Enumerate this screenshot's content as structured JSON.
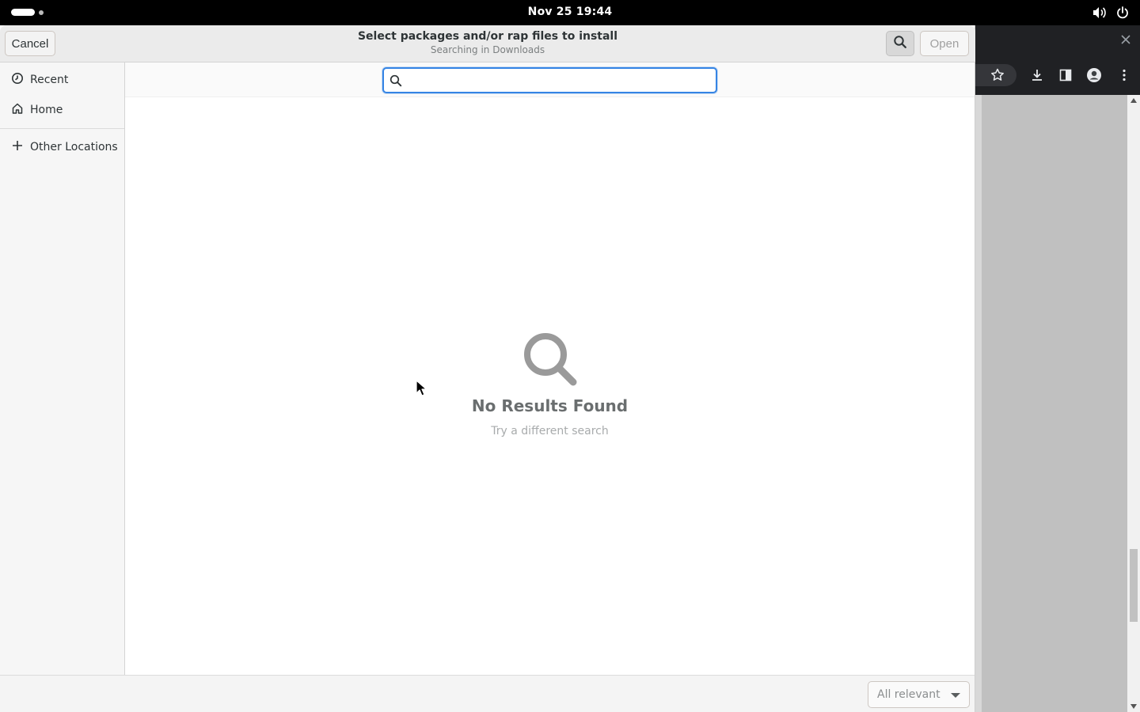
{
  "topbar": {
    "clock": "Nov 25  19:44"
  },
  "dialog": {
    "title": "Select packages and/or rap files to install",
    "subtitle": "Searching in Downloads",
    "cancel_label": "Cancel",
    "open_label": "Open",
    "search_toggle_icon": "search-icon"
  },
  "sidebar": {
    "items": [
      {
        "label": "Recent",
        "icon": "clock-icon"
      },
      {
        "label": "Home",
        "icon": "home-icon"
      },
      {
        "label": "Other Locations",
        "icon": "plus-icon"
      }
    ]
  },
  "search": {
    "value": "",
    "placeholder": ""
  },
  "empty_state": {
    "icon": "search-icon",
    "title": "No Results Found",
    "subtitle": "Try a different search"
  },
  "filter": {
    "selected": "All relevant"
  },
  "colors": {
    "accent": "#3584e4",
    "headerbar": "#ebebeb",
    "sidebar": "#f6f6f6"
  }
}
